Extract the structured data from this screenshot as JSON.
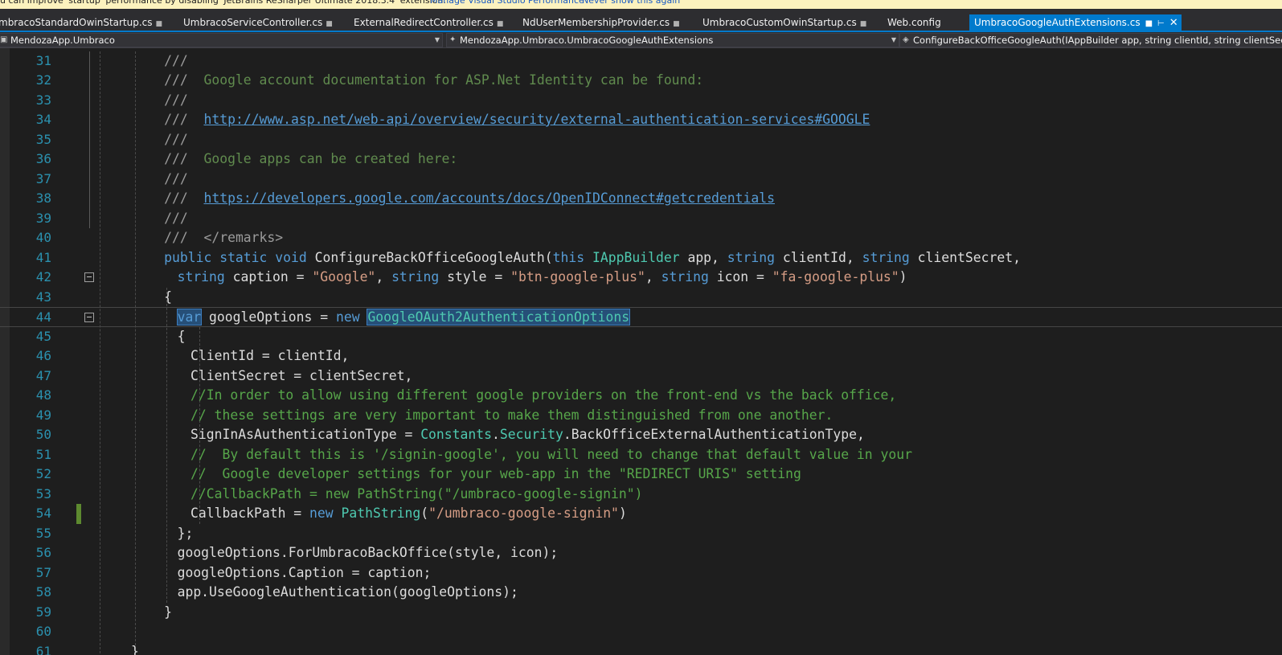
{
  "infobar": {
    "message": "u can improve 'startup' performance by disabling 'JetBrains ReSharper Ultimate 2018.3.4' extension.",
    "link_manage": "Manage Visual Studio Performance",
    "link_never": "Never show this again"
  },
  "tabs": [
    {
      "label": "mbracoStandardOwinStartup.cs",
      "pinned": true
    },
    {
      "label": "UmbracoServiceController.cs",
      "pinned": true
    },
    {
      "label": "ExternalRedirectController.cs",
      "pinned": true
    },
    {
      "label": "NdUserMembershipProvider.cs",
      "pinned": true
    },
    {
      "label": "UmbracoCustomOwinStartup.cs",
      "pinned": true
    },
    {
      "label": "Web.config",
      "pinned": false
    },
    {
      "label": "UmbracoGoogleAuthExtensions.cs",
      "pinned": true,
      "active": true
    }
  ],
  "navbar": {
    "project": "MendozaApp.Umbraco",
    "class": "MendozaApp.Umbraco.UmbracoGoogleAuthExtensions",
    "member": "ConfigureBackOfficeGoogleAuth(IAppBuilder app, string clientId, string clientSecret, string caption = \"Google\", string style = \"btn-google-plus\", string icon = \"fa-google-plus\")"
  },
  "editor": {
    "current_line": 44,
    "lines": [
      {
        "n": 31,
        "indent": 10,
        "tokens": [
          {
            "t": "///",
            "c": "gray"
          }
        ]
      },
      {
        "n": 32,
        "indent": 10,
        "tokens": [
          {
            "t": "///",
            "c": "gray"
          },
          {
            "t": "  Google account documentation for ASP.Net Identity can be found:",
            "c": "doc"
          }
        ]
      },
      {
        "n": 33,
        "indent": 10,
        "tokens": [
          {
            "t": "///",
            "c": "gray"
          }
        ]
      },
      {
        "n": 34,
        "indent": 10,
        "tokens": [
          {
            "t": "///",
            "c": "gray"
          },
          {
            "t": "  ",
            "c": "doc"
          },
          {
            "t": "http://www.asp.net/web-api/overview/security/external-authentication-services#GOOGLE",
            "c": "link"
          }
        ]
      },
      {
        "n": 35,
        "indent": 10,
        "tokens": [
          {
            "t": "///",
            "c": "gray"
          }
        ]
      },
      {
        "n": 36,
        "indent": 10,
        "tokens": [
          {
            "t": "///",
            "c": "gray"
          },
          {
            "t": "  Google apps can be created here:",
            "c": "doc"
          }
        ]
      },
      {
        "n": 37,
        "indent": 10,
        "tokens": [
          {
            "t": "///",
            "c": "gray"
          }
        ]
      },
      {
        "n": 38,
        "indent": 10,
        "tokens": [
          {
            "t": "///",
            "c": "gray"
          },
          {
            "t": "  ",
            "c": "doc"
          },
          {
            "t": "https://developers.google.com/accounts/docs/OpenIDConnect#getcredentials",
            "c": "link"
          }
        ]
      },
      {
        "n": 39,
        "indent": 10,
        "tokens": [
          {
            "t": "///",
            "c": "gray"
          }
        ]
      },
      {
        "n": 40,
        "indent": 10,
        "tokens": [
          {
            "t": "///",
            "c": "gray"
          },
          {
            "t": "  </remarks>",
            "c": "gray"
          }
        ]
      },
      {
        "n": 41,
        "indent": 10,
        "tokens": [
          {
            "t": "public static void ",
            "c": "kw"
          },
          {
            "t": "ConfigureBackOfficeGoogleAuth(",
            "c": ""
          },
          {
            "t": "this ",
            "c": "kw"
          },
          {
            "t": "IAppBuilder",
            "c": "type"
          },
          {
            "t": " app, ",
            "c": ""
          },
          {
            "t": "string",
            "c": "kw"
          },
          {
            "t": " clientId, ",
            "c": ""
          },
          {
            "t": "string",
            "c": "kw"
          },
          {
            "t": " clientSecret,",
            "c": ""
          }
        ]
      },
      {
        "n": 42,
        "indent": 14,
        "fold": true,
        "tokens": [
          {
            "t": "string",
            "c": "kw"
          },
          {
            "t": " caption = ",
            "c": ""
          },
          {
            "t": "\"Google\"",
            "c": "str"
          },
          {
            "t": ", ",
            "c": ""
          },
          {
            "t": "string",
            "c": "kw"
          },
          {
            "t": " style = ",
            "c": ""
          },
          {
            "t": "\"btn-google-plus\"",
            "c": "str"
          },
          {
            "t": ", ",
            "c": ""
          },
          {
            "t": "string",
            "c": "kw"
          },
          {
            "t": " icon = ",
            "c": ""
          },
          {
            "t": "\"fa-google-plus\"",
            "c": "str"
          },
          {
            "t": ")",
            "c": ""
          }
        ]
      },
      {
        "n": 43,
        "indent": 10,
        "tokens": [
          {
            "t": "{",
            "c": ""
          }
        ]
      },
      {
        "n": 44,
        "indent": 14,
        "fold": true,
        "tokens": [
          {
            "t": "var",
            "c": "kw",
            "hl": true
          },
          {
            "t": " googleOptions = ",
            "c": ""
          },
          {
            "t": "new ",
            "c": "kw"
          },
          {
            "t": "GoogleOAuth2AuthenticationOptions",
            "c": "type",
            "hl": true
          }
        ]
      },
      {
        "n": 45,
        "indent": 14,
        "tokens": [
          {
            "t": "{",
            "c": ""
          }
        ]
      },
      {
        "n": 46,
        "indent": 18,
        "tokens": [
          {
            "t": "ClientId = clientId,",
            "c": ""
          }
        ]
      },
      {
        "n": 47,
        "indent": 18,
        "tokens": [
          {
            "t": "ClientSecret = clientSecret,",
            "c": ""
          }
        ]
      },
      {
        "n": 48,
        "indent": 18,
        "tokens": [
          {
            "t": "//In order to allow using different google providers on the front-end vs the back office,",
            "c": "cm"
          }
        ]
      },
      {
        "n": 49,
        "indent": 18,
        "tokens": [
          {
            "t": "// these settings are very important to make them distinguished from one another.",
            "c": "cm"
          }
        ]
      },
      {
        "n": 50,
        "indent": 18,
        "tokens": [
          {
            "t": "SignInAsAuthenticationType = ",
            "c": ""
          },
          {
            "t": "Constants",
            "c": "type"
          },
          {
            "t": ".",
            "c": ""
          },
          {
            "t": "Security",
            "c": "type"
          },
          {
            "t": ".BackOfficeExternalAuthenticationType,",
            "c": ""
          }
        ]
      },
      {
        "n": 51,
        "indent": 18,
        "tokens": [
          {
            "t": "//  By default this is '/signin-google', you will need to change that default value in your",
            "c": "cm"
          }
        ]
      },
      {
        "n": 52,
        "indent": 18,
        "tokens": [
          {
            "t": "//  Google developer settings for your web-app in the \"REDIRECT URIS\" setting",
            "c": "cm"
          }
        ]
      },
      {
        "n": 53,
        "indent": 18,
        "tokens": [
          {
            "t": "//CallbackPath = new PathString(\"/umbraco-google-signin\")",
            "c": "cm"
          }
        ]
      },
      {
        "n": 54,
        "indent": 18,
        "changed": true,
        "tokens": [
          {
            "t": "CallbackPath = ",
            "c": ""
          },
          {
            "t": "new ",
            "c": "kw"
          },
          {
            "t": "PathString",
            "c": "type"
          },
          {
            "t": "(",
            "c": ""
          },
          {
            "t": "\"/umbraco-google-signin\"",
            "c": "str"
          },
          {
            "t": ")",
            "c": ""
          }
        ]
      },
      {
        "n": 55,
        "indent": 14,
        "tokens": [
          {
            "t": "};",
            "c": ""
          }
        ]
      },
      {
        "n": 56,
        "indent": 14,
        "tokens": [
          {
            "t": "googleOptions.ForUmbracoBackOffice(style, icon);",
            "c": ""
          }
        ]
      },
      {
        "n": 57,
        "indent": 14,
        "tokens": [
          {
            "t": "googleOptions.Caption = caption;",
            "c": ""
          }
        ]
      },
      {
        "n": 58,
        "indent": 14,
        "tokens": [
          {
            "t": "app.UseGoogleAuthentication(googleOptions);",
            "c": ""
          }
        ]
      },
      {
        "n": 59,
        "indent": 10,
        "tokens": [
          {
            "t": "}",
            "c": ""
          }
        ]
      },
      {
        "n": 60,
        "indent": 0,
        "tokens": []
      },
      {
        "n": 61,
        "indent": 0,
        "tokens": [
          {
            "t": "}",
            "c": ""
          }
        ]
      }
    ]
  },
  "colors": {
    "keyword": "#569cd6",
    "type": "#4ec9b0",
    "string": "#d69d85",
    "comment": "#57a64a",
    "line_number": "#2b91af",
    "tab_active": "#007acc"
  }
}
